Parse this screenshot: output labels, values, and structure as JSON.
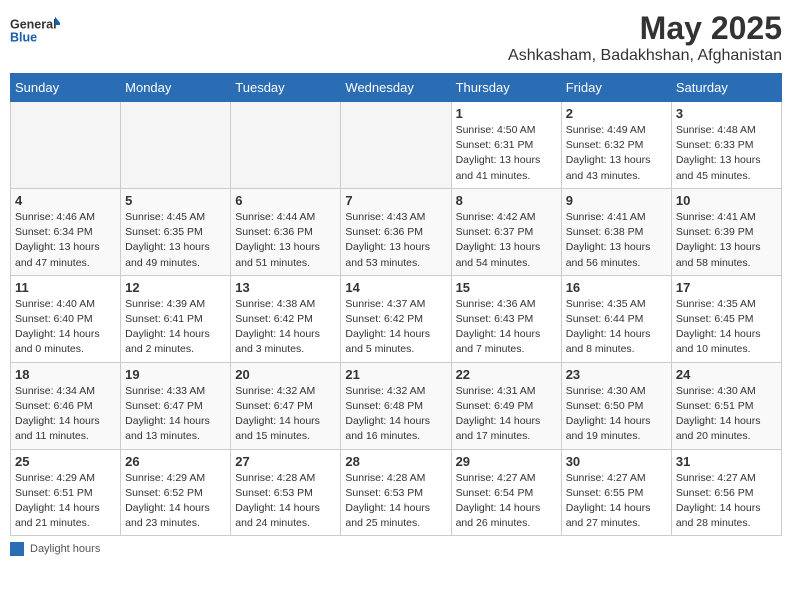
{
  "logo": {
    "text_general": "General",
    "text_blue": "Blue"
  },
  "title": "May 2025",
  "subtitle": "Ashkasham, Badakhshan, Afghanistan",
  "day_headers": [
    "Sunday",
    "Monday",
    "Tuesday",
    "Wednesday",
    "Thursday",
    "Friday",
    "Saturday"
  ],
  "weeks": [
    [
      {
        "day": "",
        "detail": ""
      },
      {
        "day": "",
        "detail": ""
      },
      {
        "day": "",
        "detail": ""
      },
      {
        "day": "",
        "detail": ""
      },
      {
        "day": "1",
        "detail": "Sunrise: 4:50 AM\nSunset: 6:31 PM\nDaylight: 13 hours\nand 41 minutes."
      },
      {
        "day": "2",
        "detail": "Sunrise: 4:49 AM\nSunset: 6:32 PM\nDaylight: 13 hours\nand 43 minutes."
      },
      {
        "day": "3",
        "detail": "Sunrise: 4:48 AM\nSunset: 6:33 PM\nDaylight: 13 hours\nand 45 minutes."
      }
    ],
    [
      {
        "day": "4",
        "detail": "Sunrise: 4:46 AM\nSunset: 6:34 PM\nDaylight: 13 hours\nand 47 minutes."
      },
      {
        "day": "5",
        "detail": "Sunrise: 4:45 AM\nSunset: 6:35 PM\nDaylight: 13 hours\nand 49 minutes."
      },
      {
        "day": "6",
        "detail": "Sunrise: 4:44 AM\nSunset: 6:36 PM\nDaylight: 13 hours\nand 51 minutes."
      },
      {
        "day": "7",
        "detail": "Sunrise: 4:43 AM\nSunset: 6:36 PM\nDaylight: 13 hours\nand 53 minutes."
      },
      {
        "day": "8",
        "detail": "Sunrise: 4:42 AM\nSunset: 6:37 PM\nDaylight: 13 hours\nand 54 minutes."
      },
      {
        "day": "9",
        "detail": "Sunrise: 4:41 AM\nSunset: 6:38 PM\nDaylight: 13 hours\nand 56 minutes."
      },
      {
        "day": "10",
        "detail": "Sunrise: 4:41 AM\nSunset: 6:39 PM\nDaylight: 13 hours\nand 58 minutes."
      }
    ],
    [
      {
        "day": "11",
        "detail": "Sunrise: 4:40 AM\nSunset: 6:40 PM\nDaylight: 14 hours\nand 0 minutes."
      },
      {
        "day": "12",
        "detail": "Sunrise: 4:39 AM\nSunset: 6:41 PM\nDaylight: 14 hours\nand 2 minutes."
      },
      {
        "day": "13",
        "detail": "Sunrise: 4:38 AM\nSunset: 6:42 PM\nDaylight: 14 hours\nand 3 minutes."
      },
      {
        "day": "14",
        "detail": "Sunrise: 4:37 AM\nSunset: 6:42 PM\nDaylight: 14 hours\nand 5 minutes."
      },
      {
        "day": "15",
        "detail": "Sunrise: 4:36 AM\nSunset: 6:43 PM\nDaylight: 14 hours\nand 7 minutes."
      },
      {
        "day": "16",
        "detail": "Sunrise: 4:35 AM\nSunset: 6:44 PM\nDaylight: 14 hours\nand 8 minutes."
      },
      {
        "day": "17",
        "detail": "Sunrise: 4:35 AM\nSunset: 6:45 PM\nDaylight: 14 hours\nand 10 minutes."
      }
    ],
    [
      {
        "day": "18",
        "detail": "Sunrise: 4:34 AM\nSunset: 6:46 PM\nDaylight: 14 hours\nand 11 minutes."
      },
      {
        "day": "19",
        "detail": "Sunrise: 4:33 AM\nSunset: 6:47 PM\nDaylight: 14 hours\nand 13 minutes."
      },
      {
        "day": "20",
        "detail": "Sunrise: 4:32 AM\nSunset: 6:47 PM\nDaylight: 14 hours\nand 15 minutes."
      },
      {
        "day": "21",
        "detail": "Sunrise: 4:32 AM\nSunset: 6:48 PM\nDaylight: 14 hours\nand 16 minutes."
      },
      {
        "day": "22",
        "detail": "Sunrise: 4:31 AM\nSunset: 6:49 PM\nDaylight: 14 hours\nand 17 minutes."
      },
      {
        "day": "23",
        "detail": "Sunrise: 4:30 AM\nSunset: 6:50 PM\nDaylight: 14 hours\nand 19 minutes."
      },
      {
        "day": "24",
        "detail": "Sunrise: 4:30 AM\nSunset: 6:51 PM\nDaylight: 14 hours\nand 20 minutes."
      }
    ],
    [
      {
        "day": "25",
        "detail": "Sunrise: 4:29 AM\nSunset: 6:51 PM\nDaylight: 14 hours\nand 21 minutes."
      },
      {
        "day": "26",
        "detail": "Sunrise: 4:29 AM\nSunset: 6:52 PM\nDaylight: 14 hours\nand 23 minutes."
      },
      {
        "day": "27",
        "detail": "Sunrise: 4:28 AM\nSunset: 6:53 PM\nDaylight: 14 hours\nand 24 minutes."
      },
      {
        "day": "28",
        "detail": "Sunrise: 4:28 AM\nSunset: 6:53 PM\nDaylight: 14 hours\nand 25 minutes."
      },
      {
        "day": "29",
        "detail": "Sunrise: 4:27 AM\nSunset: 6:54 PM\nDaylight: 14 hours\nand 26 minutes."
      },
      {
        "day": "30",
        "detail": "Sunrise: 4:27 AM\nSunset: 6:55 PM\nDaylight: 14 hours\nand 27 minutes."
      },
      {
        "day": "31",
        "detail": "Sunrise: 4:27 AM\nSunset: 6:56 PM\nDaylight: 14 hours\nand 28 minutes."
      }
    ]
  ],
  "footer": {
    "daylight_hours_label": "Daylight hours"
  }
}
